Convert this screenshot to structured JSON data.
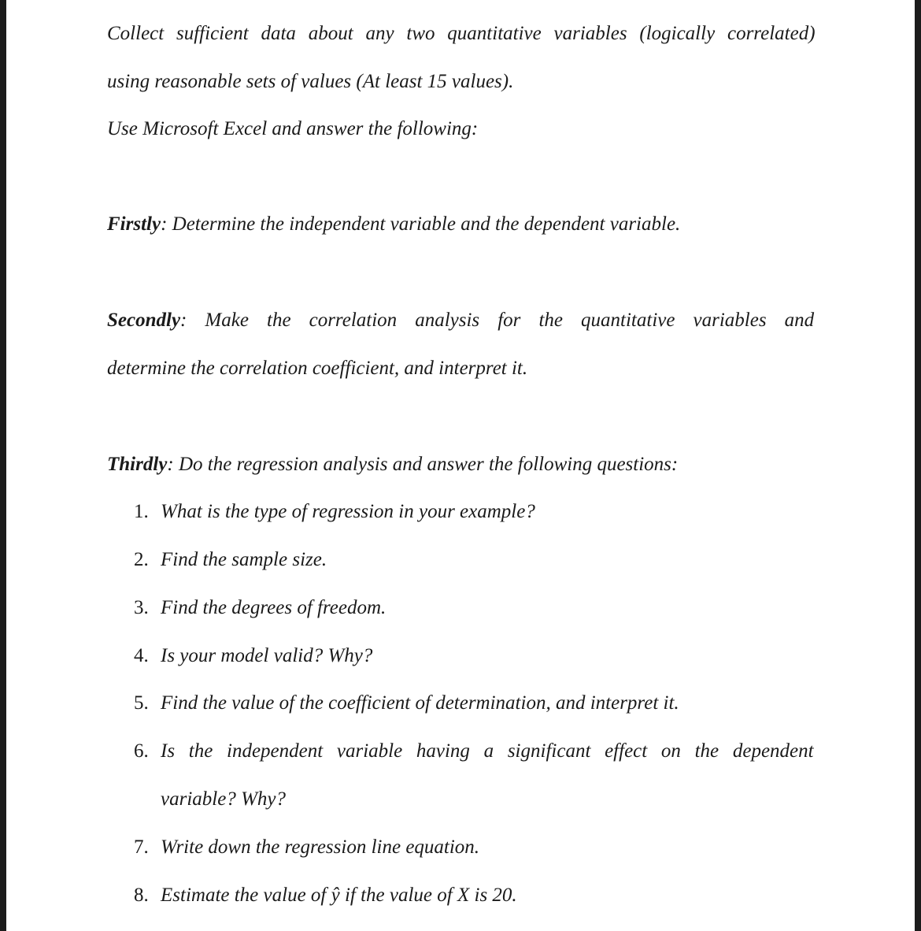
{
  "document": {
    "intro": {
      "line1": "Collect sufficient data about any two quantitative variables (logically correlated)",
      "line2": "using reasonable sets of values (At least 15 values).",
      "line3": "Use Microsoft Excel and answer the following:"
    },
    "firstly": {
      "label": "Firstly",
      "text": ": Determine the independent variable and the dependent variable."
    },
    "secondly": {
      "label": "Secondly",
      "line1_rest": ":  Make  the  correlation  analysis  for  the  quantitative  variables  and",
      "line2": "determine the correlation coefficient, and interpret it."
    },
    "thirdly": {
      "label": "Thirdly",
      "text": ": Do the regression analysis and answer the following questions:"
    },
    "questions": [
      {
        "num": "1.",
        "text": "What is the type of regression in your example?"
      },
      {
        "num": "2.",
        "text": "Find the sample size."
      },
      {
        "num": "3.",
        "text": "Find the degrees of freedom."
      },
      {
        "num": "4.",
        "text": "Is your model valid? Why?"
      },
      {
        "num": "5.",
        "text": "Find the value of the coefficient of determination, and interpret it."
      },
      {
        "num": "6.",
        "text": "Is  the  independent  variable  having  a  significant  effect  on  the  dependent",
        "continuation": "variable? Why?"
      },
      {
        "num": "7.",
        "text": "Write down the regression line equation."
      },
      {
        "num": "8.",
        "text": "Estimate the value of ŷ if the value of X is 20."
      }
    ]
  }
}
